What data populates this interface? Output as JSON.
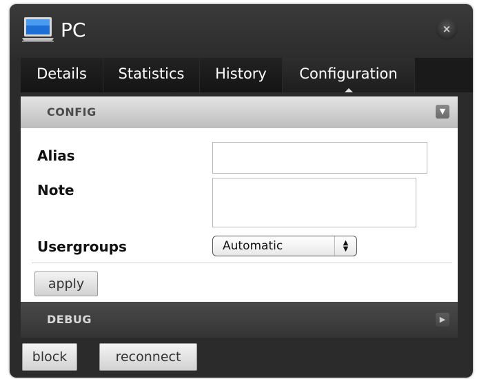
{
  "window": {
    "title": "PC",
    "close_glyph": "×"
  },
  "tabs": [
    {
      "label": "Details",
      "active": false
    },
    {
      "label": "Statistics",
      "active": false
    },
    {
      "label": "History",
      "active": false
    },
    {
      "label": "Configuration",
      "active": true
    }
  ],
  "config": {
    "header": "CONFIG",
    "toggle_icon": "chevron-down-icon",
    "alias": {
      "label": "Alias",
      "value": ""
    },
    "note": {
      "label": "Note",
      "value": ""
    },
    "usergroups": {
      "label": "Usergroups",
      "selected": "Automatic"
    },
    "apply_label": "apply"
  },
  "debug": {
    "header": "DEBUG",
    "toggle_icon": "chevron-right-icon"
  },
  "footer": {
    "block_label": "block",
    "reconnect_label": "reconnect"
  },
  "colors": {
    "window_bg": "#2b2b2b",
    "config_header_bg": "#c8c8c8",
    "debug_header_bg": "#3c3c3c"
  }
}
